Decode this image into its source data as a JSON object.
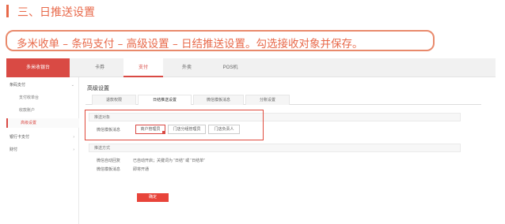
{
  "heading": {
    "title": "三、日推送设置"
  },
  "instruction": {
    "text": "多米收单 – 条码支付 – 高级设置 – 日结推送设置。勾选接收对象并保存。"
  },
  "app": {
    "brand": "多米收银台",
    "top_nav": [
      "卡券",
      "支付",
      "外卖",
      "POS机"
    ],
    "active_top_nav": "支付",
    "sidebar": [
      {
        "label": "条码支付",
        "kind": "group",
        "chevron": "⌄"
      },
      {
        "label": "支付收单台",
        "kind": "sub"
      },
      {
        "label": "收款账户",
        "kind": "sub"
      },
      {
        "label": "高级设置",
        "kind": "sub",
        "active": true
      },
      {
        "label": "银行卡支付",
        "kind": "group",
        "chevron": "›"
      },
      {
        "label": "财付",
        "kind": "group",
        "chevron": "›"
      }
    ],
    "page_title": "高级设置",
    "tabs": [
      "退款权限",
      "日结推送设置",
      "微信模板消息",
      "分账设置"
    ],
    "active_tab": "日结推送设置",
    "push_target": {
      "header": "推送对象",
      "row_label": "微信模板消息",
      "options": [
        {
          "label": "商户管理员",
          "checked": true
        },
        {
          "label": "门店分组管理员",
          "checked": false
        },
        {
          "label": "门店负责人",
          "checked": false
        }
      ]
    },
    "push_method": {
      "header": "推送方式",
      "rows": [
        {
          "label": "微信自动回复",
          "value": "已自动开启；关键词为 “日结” 或 “日结单”"
        },
        {
          "label": "微信模板消息",
          "value": "即将开通"
        }
      ]
    },
    "confirm_label": "确定",
    "colors": {
      "accent": "#e8694a",
      "brand_red": "#d94a44",
      "highlight": "#e04a3c"
    }
  }
}
